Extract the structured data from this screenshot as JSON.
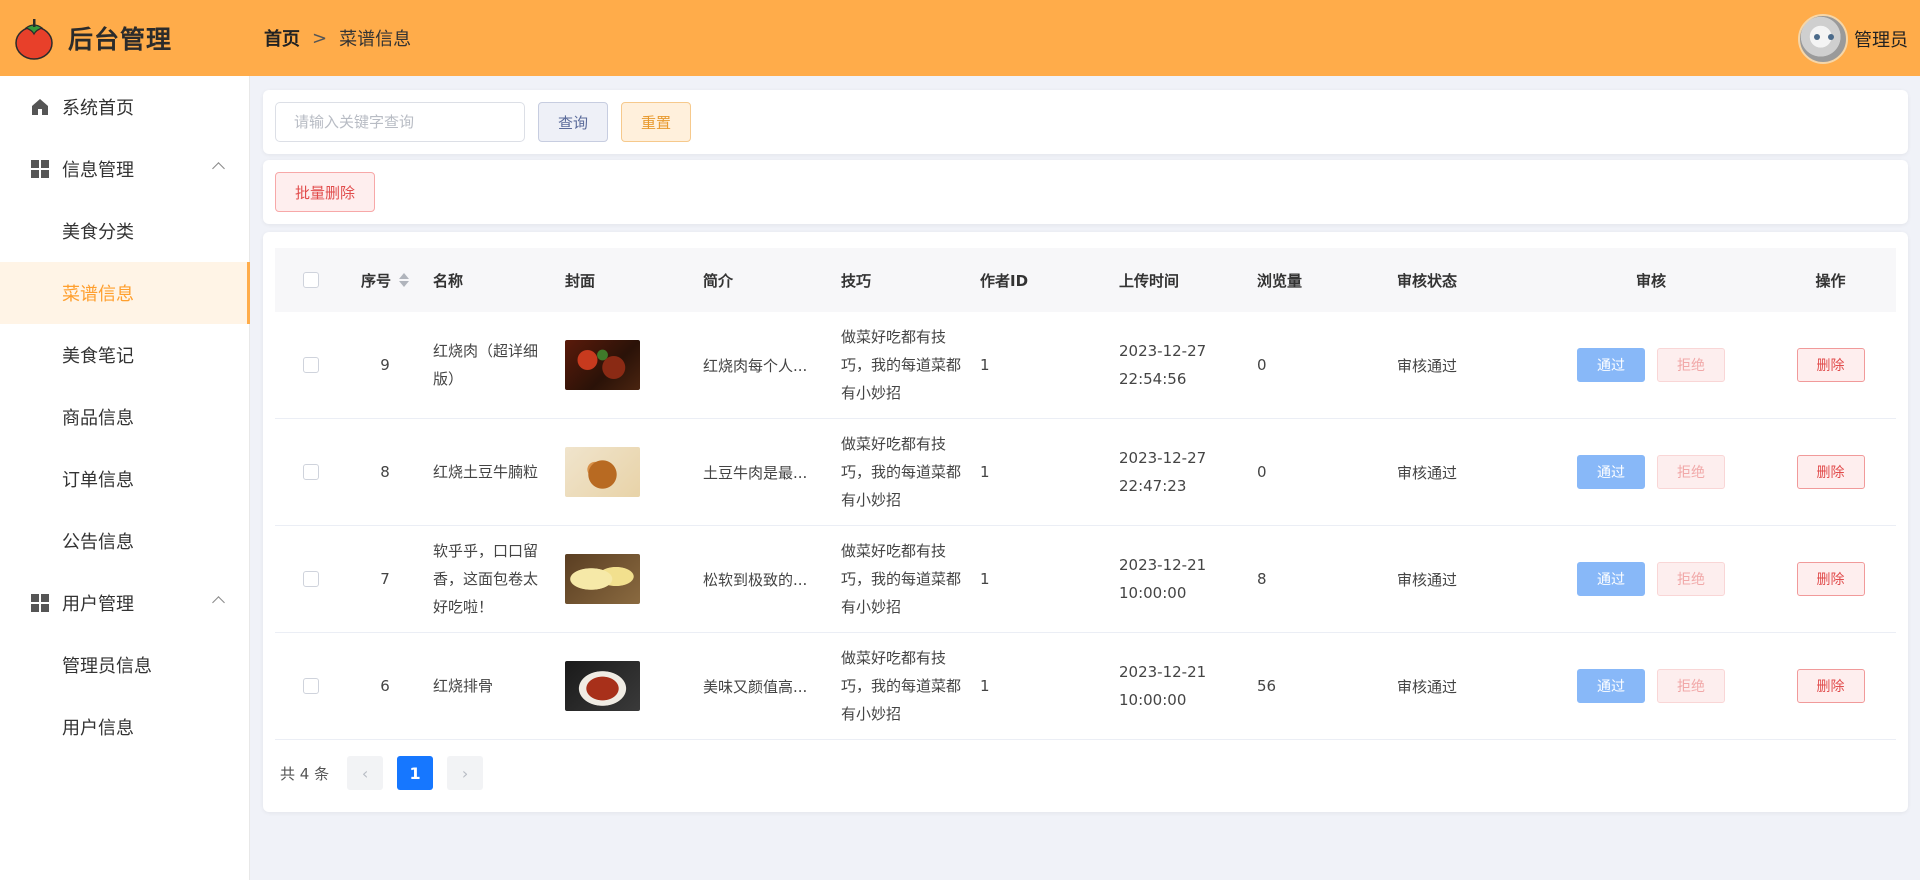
{
  "app": {
    "title": "后台管理"
  },
  "breadcrumb": {
    "home": "首页",
    "separator": ">",
    "current": "菜谱信息"
  },
  "user": {
    "name": "管理员"
  },
  "sidebar": {
    "home": "系统首页",
    "group_info": {
      "label": "信息管理",
      "items": [
        "美食分类",
        "菜谱信息",
        "美食笔记",
        "商品信息",
        "订单信息",
        "公告信息"
      ]
    },
    "group_user": {
      "label": "用户管理",
      "items": [
        "管理员信息",
        "用户信息"
      ]
    },
    "active": "菜谱信息"
  },
  "search": {
    "placeholder": "请输入关键字查询",
    "value": "",
    "query_label": "查询",
    "reset_label": "重置"
  },
  "toolbar": {
    "bulk_delete_label": "批量删除"
  },
  "table": {
    "columns": {
      "index": "序号",
      "name": "名称",
      "cover": "封面",
      "intro": "简介",
      "tips": "技巧",
      "author": "作者ID",
      "time": "上传时间",
      "views": "浏览量",
      "status": "审核状态",
      "review": "审核",
      "op": "操作"
    },
    "rows": [
      {
        "index": "9",
        "name": "红烧肉（超详细版）",
        "cover": "red-braised-pork-image",
        "intro": "红烧肉每个人...",
        "tips": "做菜好吃都有技巧，我的每道菜都有小妙招",
        "author": "1",
        "time": "2023-12-27 22:54:56",
        "views": "0",
        "status": "审核通过"
      },
      {
        "index": "8",
        "name": "红烧土豆牛腩粒",
        "cover": "potato-beef-image",
        "intro": "土豆牛肉是最...",
        "tips": "做菜好吃都有技巧，我的每道菜都有小妙招",
        "author": "1",
        "time": "2023-12-27 22:47:23",
        "views": "0",
        "status": "审核通过"
      },
      {
        "index": "7",
        "name": "软乎乎，口口留香，这面包卷太好吃啦！",
        "cover": "bread-roll-image",
        "intro": "松软到极致的...",
        "tips": "做菜好吃都有技巧，我的每道菜都有小妙招",
        "author": "1",
        "time": "2023-12-21 10:00:00",
        "views": "8",
        "status": "审核通过"
      },
      {
        "index": "6",
        "name": "红烧排骨",
        "cover": "braised-ribs-image",
        "intro": "美味又颜值高...",
        "tips": "做菜好吃都有技巧，我的每道菜都有小妙招",
        "author": "1",
        "time": "2023-12-21 10:00:00",
        "views": "56",
        "status": "审核通过"
      }
    ],
    "actions": {
      "pass": "通过",
      "reject": "拒绝",
      "delete": "删除"
    }
  },
  "pagination": {
    "total_text": "共 4 条",
    "current_page": "1",
    "prev_icon": "‹",
    "next_icon": "›"
  },
  "colors": {
    "header": "#ffac4a",
    "active_menu_bg": "#fff4e6",
    "active_menu_text": "#ff9f2e",
    "primary": "#1677ff",
    "danger": "#e14c4c"
  }
}
